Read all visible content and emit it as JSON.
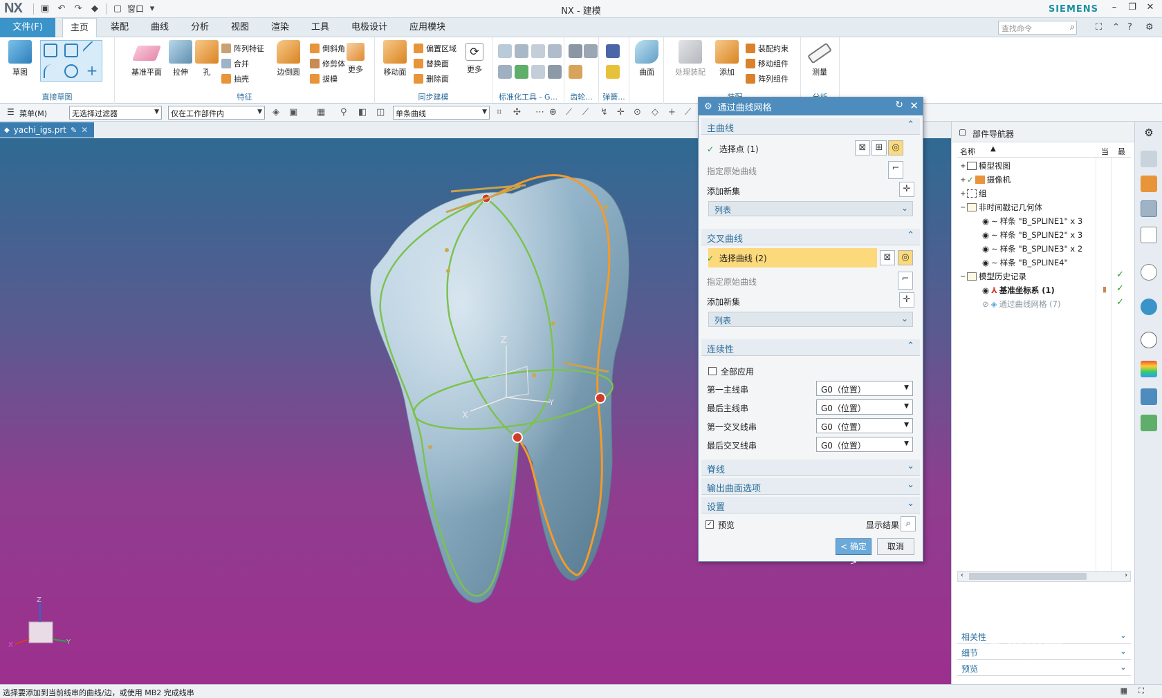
{
  "app": {
    "logo": "NX",
    "window_title": "NX - 建模",
    "brand": "SIEMENS",
    "window_label": "窗口"
  },
  "menu": {
    "file": "文件(F)",
    "tabs": [
      "主页",
      "装配",
      "曲线",
      "分析",
      "视图",
      "渲染",
      "工具",
      "电极设计",
      "应用模块"
    ],
    "search_placeholder": "查找命令"
  },
  "ribbon": {
    "sketch": {
      "label": "草图",
      "group": "直接草图"
    },
    "feature": {
      "group": "特征",
      "datum_plane": "基准平面",
      "extrude": "拉伸",
      "hole": "孔",
      "pattern_feature": "阵列特征",
      "unite": "合并",
      "shell": "抽壳",
      "edge_blend": "边倒圆",
      "chamfer": "倒斜角",
      "trim_body": "修剪体",
      "draft": "拔模",
      "more": "更多"
    },
    "sync": {
      "group": "同步建模",
      "move_face": "移动面",
      "offset_region": "偏置区域",
      "replace_face": "替换面",
      "delete_face": "删除面",
      "more": "更多"
    },
    "std_tools": {
      "group": "标准化工具 - G..."
    },
    "gear": {
      "group": "齿轮..."
    },
    "spring": {
      "group": "弹簧..."
    },
    "surface": {
      "label": "曲面"
    },
    "assembly": {
      "group": "装配",
      "process_assembly": "处理装配",
      "add": "添加",
      "assembly_constraints": "装配约束",
      "move_component": "移动组件",
      "pattern_component": "阵列组件"
    },
    "analysis": {
      "measure": "测量",
      "group": "分析"
    }
  },
  "selection_bar": {
    "menu": "菜单(M)",
    "filter": "无选择过滤器",
    "scope": "仅在工作部件内",
    "curve_rule": "单条曲线"
  },
  "document": {
    "tab": "yachi_igs.prt"
  },
  "viewport": {
    "axis_z": "Z",
    "axis_x": "X",
    "axis_y": "Y",
    "triad_z": "Z",
    "triad_x": "X",
    "triad_y": "Y"
  },
  "dialog": {
    "title": "通过曲线网格",
    "primary": {
      "header": "主曲线",
      "select_point": "选择点 (1)",
      "specify_origin": "指定原始曲线",
      "add_new_set": "添加新集",
      "list": "列表"
    },
    "cross": {
      "header": "交叉曲线",
      "select_curve": "选择曲线 (2)",
      "specify_origin": "指定原始曲线",
      "add_new_set": "添加新集",
      "list": "列表"
    },
    "continuity": {
      "header": "连续性",
      "apply_all": "全部应用",
      "rows": [
        {
          "label": "第一主线串",
          "value": "G0（位置）"
        },
        {
          "label": "最后主线串",
          "value": "G0（位置）"
        },
        {
          "label": "第一交叉线串",
          "value": "G0（位置）"
        },
        {
          "label": "最后交叉线串",
          "value": "G0（位置）"
        }
      ]
    },
    "spine": "脊线",
    "output_options": "输出曲面选项",
    "settings": "设置",
    "preview": "预览",
    "show_result": "显示结果",
    "ok": "< 确定 >",
    "cancel": "取消"
  },
  "navigator": {
    "title": "部件导航器",
    "col_name": "名称",
    "col_current": "当",
    "col_latest": "最",
    "items": [
      {
        "label": "模型视图"
      },
      {
        "label": "摄像机"
      },
      {
        "label": "组"
      },
      {
        "label": "非时间戳记几何体"
      },
      {
        "label": "样条 \"B_SPLINE1\" x 3"
      },
      {
        "label": "样条 \"B_SPLINE2\" x 3"
      },
      {
        "label": "样条 \"B_SPLINE3\" x 2"
      },
      {
        "label": "样条 \"B_SPLINE4\""
      },
      {
        "label": "模型历史记录"
      },
      {
        "label": "基准坐标系 (1)"
      },
      {
        "label": "通过曲线网格 (7)"
      }
    ],
    "footer": [
      "相关性",
      "细节",
      "预览"
    ]
  },
  "status": {
    "message": "选择要添加到当前线串的曲线/边，或使用 MB2 完成线串"
  },
  "watermark": "3D世界网",
  "colors": {
    "accent": "#3a93c9",
    "dialog_title": "#4d8cbd",
    "highlight": "#fcd97a",
    "curve_green": "#7cc24e",
    "curve_orange": "#f59a2a",
    "tooth": "#8fb1c6"
  }
}
